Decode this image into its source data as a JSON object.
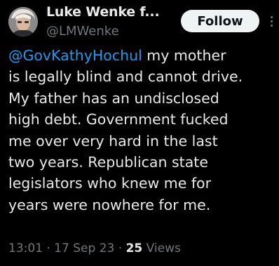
{
  "author": {
    "display_name": "Luke Wenke f...",
    "handle": "@LMWenke"
  },
  "follow_button": {
    "label": "Follow"
  },
  "more_icon": "more-vertical-icon",
  "tweet": {
    "mention": "@GovKathyHochul",
    "line1_rest": " my mother",
    "lines": [
      "is legally blind and cannot drive.",
      "My father has an undisclosed",
      "high debt.  Government fucked",
      "me over very hard in the last",
      "two years.  Republican state",
      "legislators who knew me for",
      "years were nowhere for me."
    ]
  },
  "meta": {
    "time": "13:01",
    "separator1": " · ",
    "date": "17 Sep 23",
    "separator2": " · ",
    "views_count": "25",
    "views_label": " Views"
  },
  "colors": {
    "background": "#000000",
    "text": "#e7e9ea",
    "muted": "#71767b",
    "link": "#1d9bf0",
    "button_bg": "#eff3f4"
  }
}
